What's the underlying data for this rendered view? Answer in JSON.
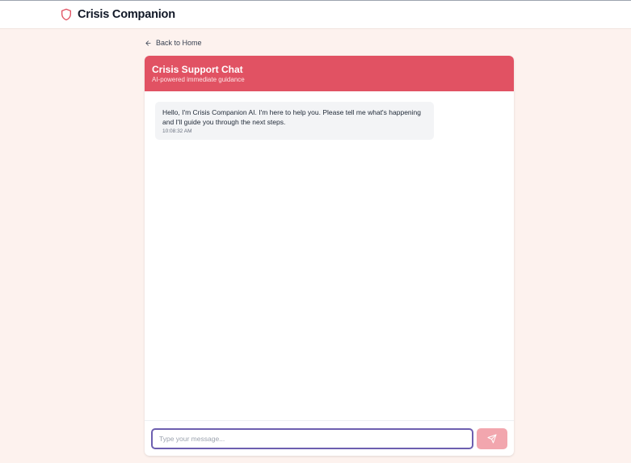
{
  "app": {
    "brand_name": "Crisis Companion",
    "logo_icon": "shield-icon"
  },
  "nav": {
    "back_label": "Back to Home",
    "back_icon": "arrow-left-icon"
  },
  "chat": {
    "title": "Crisis Support Chat",
    "subtitle": "AI-powered immediate guidance",
    "messages": [
      {
        "sender": "assistant",
        "text": "Hello, I'm Crisis Companion AI. I'm here to help you. Please tell me what's happening and I'll guide you through the next steps.",
        "time": "10:08:32 AM"
      }
    ]
  },
  "composer": {
    "placeholder": "Type your message...",
    "value": "",
    "send_icon": "send-icon"
  },
  "colors": {
    "accent": "#e15263",
    "page_background": "#fdf2ee",
    "send_button_disabled": "#f2a6ae",
    "input_focus_border": "#6d5fb0"
  }
}
